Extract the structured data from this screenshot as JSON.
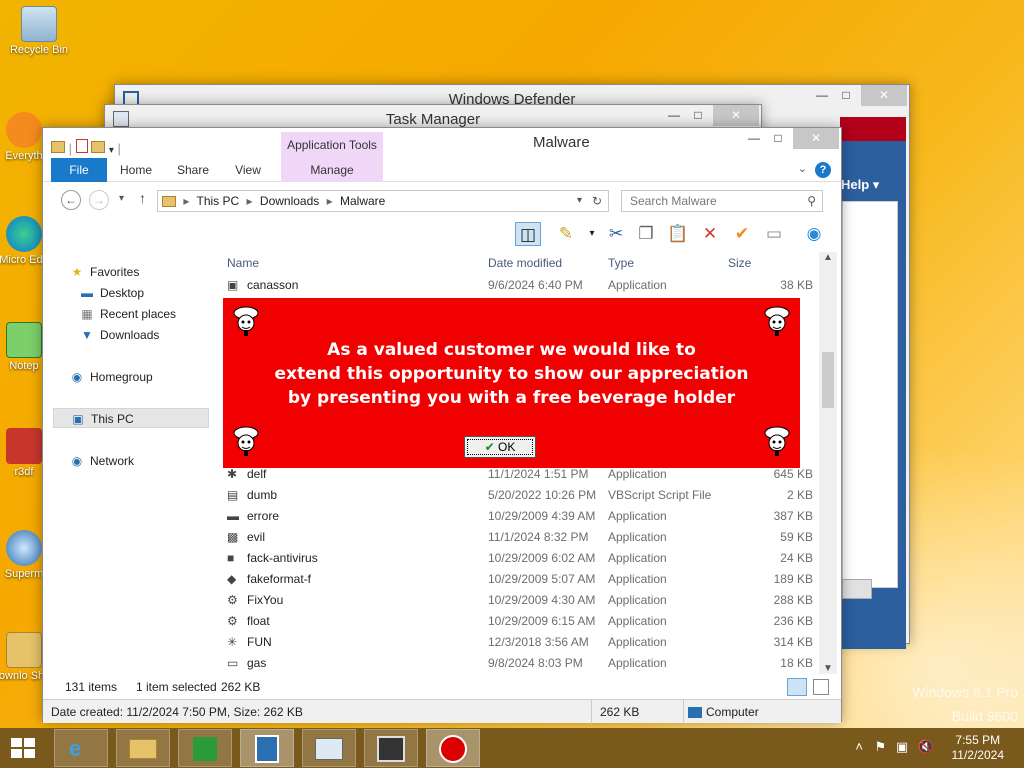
{
  "desktop": {
    "icons": [
      {
        "label": "Recycle Bin"
      },
      {
        "label": "Everyth"
      },
      {
        "label": "Micro Edg"
      },
      {
        "label": "Notep"
      },
      {
        "label": "r3df"
      },
      {
        "label": "Superm"
      },
      {
        "label": "Downlo Short"
      }
    ],
    "watermark_line1": "Windows 8.1 Pro",
    "watermark_line2": "Build 9600"
  },
  "defender": {
    "title": "Windows Defender",
    "help_label": "Help ▾"
  },
  "taskmgr": {
    "title": "Task Manager"
  },
  "explorer": {
    "title": "Malware",
    "app_tools_label": "Application Tools",
    "ribbon": {
      "file": "File",
      "home": "Home",
      "share": "Share",
      "view": "View",
      "manage": "Manage"
    },
    "address": {
      "segments": [
        "This PC",
        "Downloads",
        "Malware"
      ]
    },
    "search_placeholder": "Search Malware",
    "nav": {
      "favorites": "Favorites",
      "desktop": "Desktop",
      "recent": "Recent places",
      "downloads": "Downloads",
      "homegroup": "Homegroup",
      "thispc": "This PC",
      "network": "Network"
    },
    "columns": {
      "name": "Name",
      "date": "Date modified",
      "type": "Type",
      "size": "Size"
    },
    "files": [
      {
        "name": "canasson",
        "date": "9/6/2024 6:40 PM",
        "type": "Application",
        "size": "38 KB",
        "icon": "window-icon"
      },
      {
        "name": "delf",
        "date": "11/1/2024 1:51 PM",
        "type": "Application",
        "size": "645 KB",
        "icon": "bug-icon"
      },
      {
        "name": "dumb",
        "date": "5/20/2022 10:26 PM",
        "type": "VBScript Script File",
        "size": "2 KB",
        "icon": "script-icon"
      },
      {
        "name": "errore",
        "date": "10/29/2009 4:39 AM",
        "type": "Application",
        "size": "387 KB",
        "icon": "app-icon"
      },
      {
        "name": "evil",
        "date": "11/1/2024 8:32 PM",
        "type": "Application",
        "size": "59 KB",
        "icon": "monitor-icon"
      },
      {
        "name": "fack-antivirus",
        "date": "10/29/2009 6:02 AM",
        "type": "Application",
        "size": "24 KB",
        "icon": "shield-icon"
      },
      {
        "name": "fakeformat-f",
        "date": "10/29/2009 5:07 AM",
        "type": "Application",
        "size": "189 KB",
        "icon": "disk-icon"
      },
      {
        "name": "FixYou",
        "date": "10/29/2009 4:30 AM",
        "type": "Application",
        "size": "288 KB",
        "icon": "wrench-icon"
      },
      {
        "name": "float",
        "date": "10/29/2009 6:15 AM",
        "type": "Application",
        "size": "236 KB",
        "icon": "gear-icon"
      },
      {
        "name": "FUN",
        "date": "12/3/2018 3:56 AM",
        "type": "Application",
        "size": "314 KB",
        "icon": "spider-icon"
      },
      {
        "name": "gas",
        "date": "9/8/2024 8:03 PM",
        "type": "Application",
        "size": "18 KB",
        "icon": "gas-icon"
      }
    ],
    "status": {
      "items": "131 items",
      "selected": "1 item selected",
      "size": "262 KB"
    },
    "details": {
      "created": "Date created: 11/2/2024 7:50 PM, Size: 262 KB",
      "size": "262 KB",
      "location": "Computer"
    }
  },
  "popup": {
    "line1": "As a valued customer we would like to",
    "line2": "extend this opportunity to show our appreciation",
    "line3": "by presenting you with a free beverage holder",
    "ok": "OK"
  },
  "taskbar": {
    "time": "7:55 PM",
    "date": "11/2/2024"
  },
  "colors": {
    "popup_red": "#f00000",
    "ribbon_file": "#1979ca",
    "app_tools": "#f1d7f7"
  }
}
